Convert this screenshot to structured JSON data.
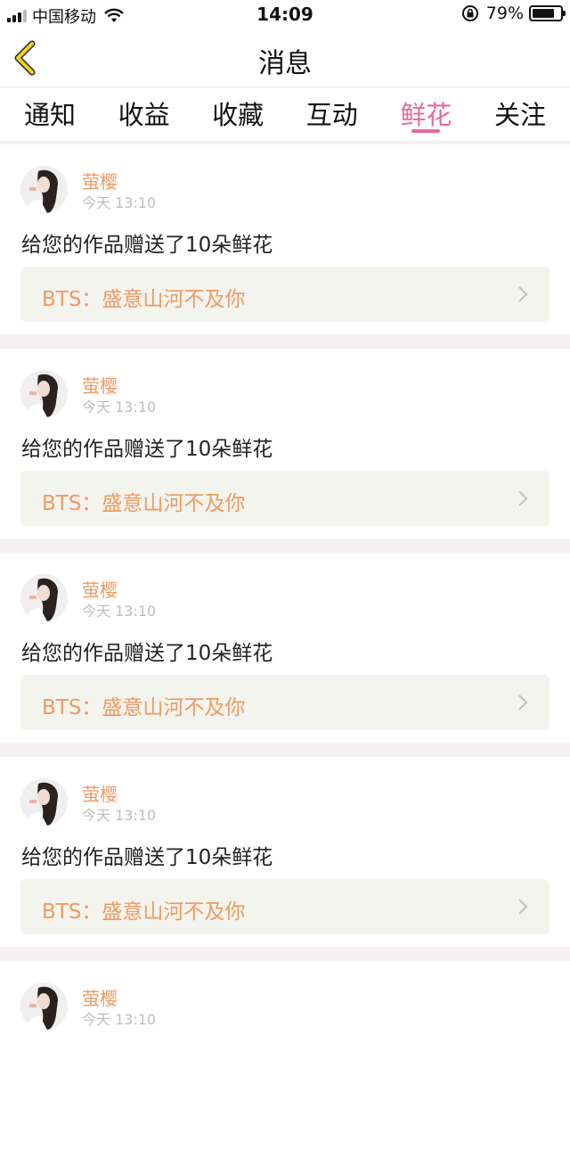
{
  "status_bar": {
    "carrier": "中国移动",
    "time": "14:09",
    "battery_percent": "79%",
    "battery_level": 0.79
  },
  "nav": {
    "title": "消息"
  },
  "tabs": [
    {
      "label": "通知",
      "active": false
    },
    {
      "label": "收益",
      "active": false
    },
    {
      "label": "收藏",
      "active": false
    },
    {
      "label": "互动",
      "active": false
    },
    {
      "label": "鲜花",
      "active": true
    },
    {
      "label": "关注",
      "active": false
    }
  ],
  "messages": [
    {
      "sender": "萤樱",
      "time": "今天 13:10",
      "text": "给您的作品赠送了10朵鲜花",
      "work": "BTS：盛意山河不及你"
    },
    {
      "sender": "萤樱",
      "time": "今天 13:10",
      "text": "给您的作品赠送了10朵鲜花",
      "work": "BTS：盛意山河不及你"
    },
    {
      "sender": "萤樱",
      "time": "今天 13:10",
      "text": "给您的作品赠送了10朵鲜花",
      "work": "BTS：盛意山河不及你"
    },
    {
      "sender": "萤樱",
      "time": "今天 13:10",
      "text": "给您的作品赠送了10朵鲜花",
      "work": "BTS：盛意山河不及你"
    },
    {
      "sender": "萤樱",
      "time": "今天 13:10",
      "text": "",
      "work": ""
    }
  ],
  "colors": {
    "accent_pink": "#e8699e",
    "accent_orange": "#ef9a63",
    "back_icon_yellow": "#f2d21b"
  }
}
